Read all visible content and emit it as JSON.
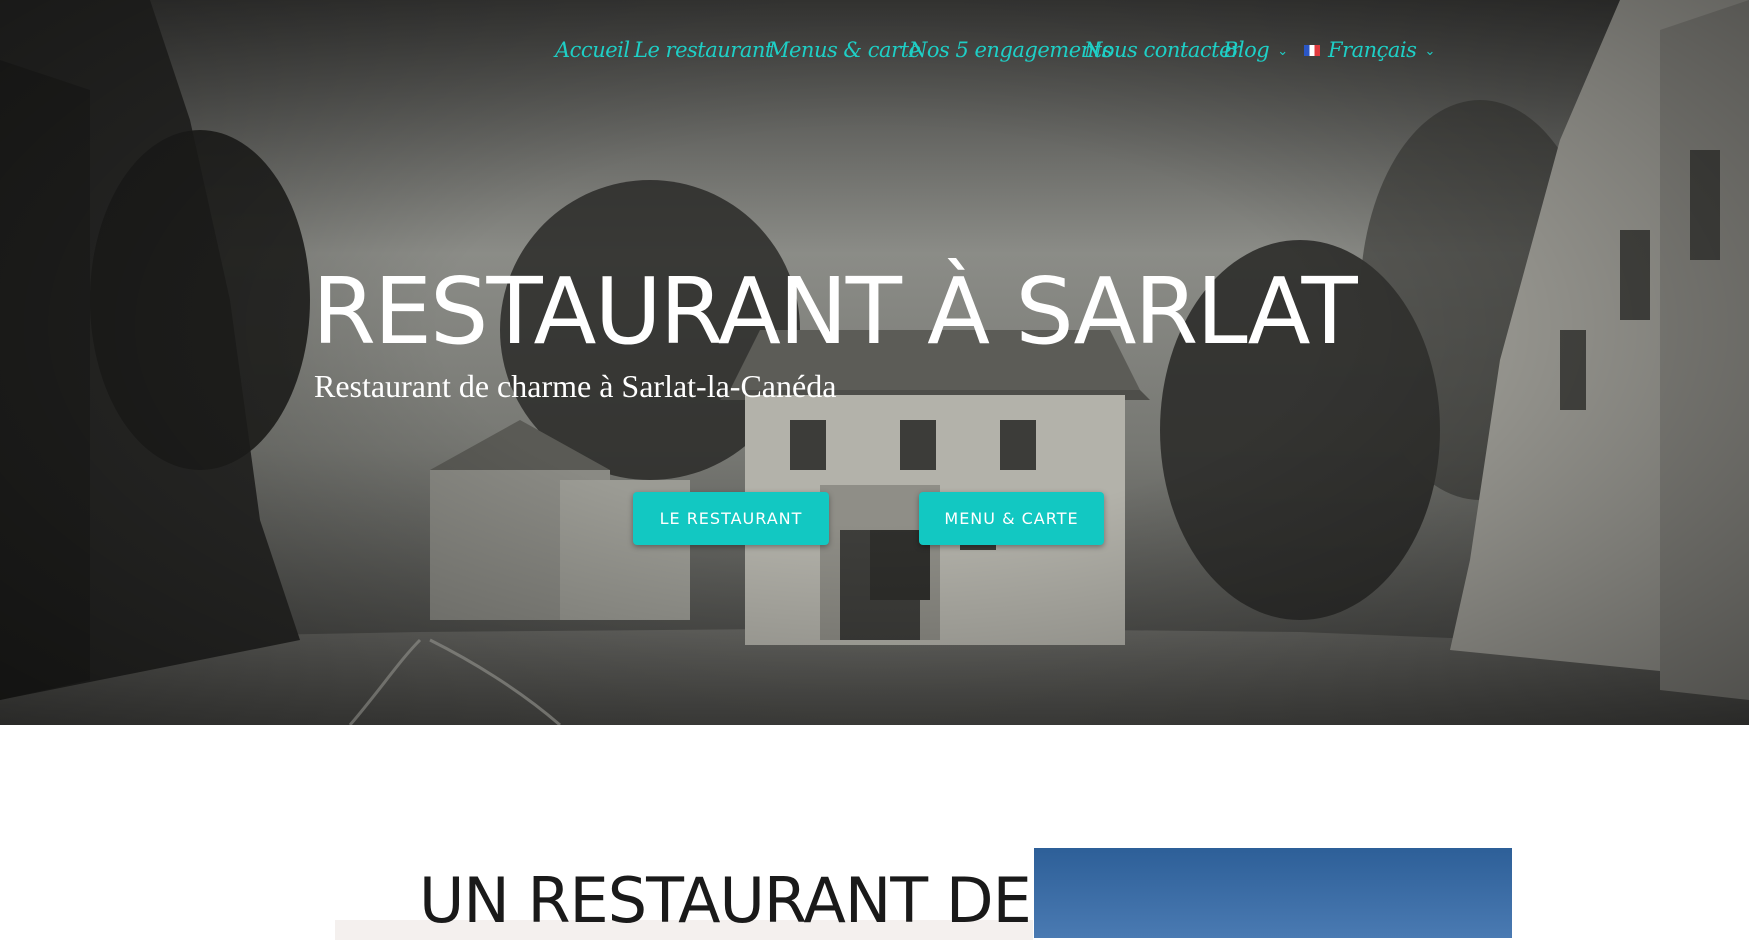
{
  "nav": {
    "items": [
      {
        "label": "Accueil"
      },
      {
        "label": "Le restaurant"
      },
      {
        "label": "Menus & carte"
      },
      {
        "label": "Nos 5 engagements"
      },
      {
        "label": "Nous contacter"
      },
      {
        "label": "Blog",
        "has_dropdown": true
      },
      {
        "label": "Français",
        "has_dropdown": true,
        "icon": "french-flag-icon"
      }
    ],
    "color": "#1ecfc6"
  },
  "hero": {
    "title": "RESTAURANT À SARLAT",
    "subtitle": "Restaurant de charme à Sarlat-la-Canéda",
    "buttons": [
      {
        "label": "LE RESTAURANT"
      },
      {
        "label": "MENU & CARTE"
      }
    ],
    "button_color": "#12c8c2"
  },
  "section": {
    "title": "UN RESTAURANT DE"
  }
}
